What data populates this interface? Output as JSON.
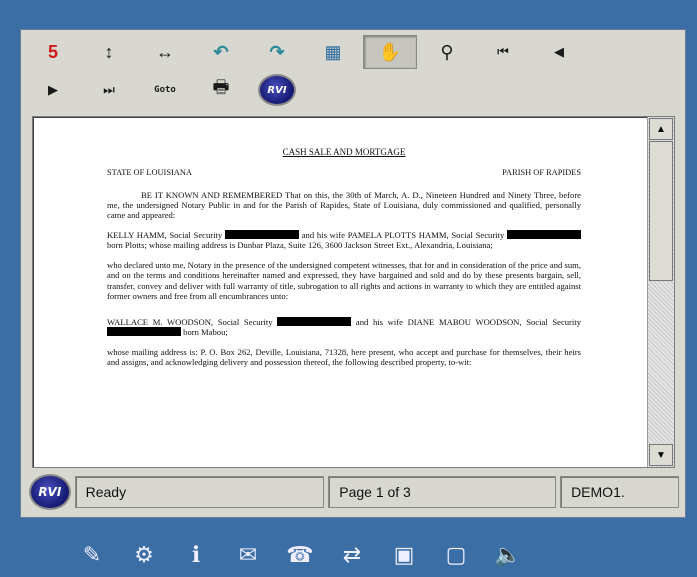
{
  "toolbar": {
    "row1": [
      {
        "name": "first-page-icon",
        "glyph": "5"
      },
      {
        "name": "fit-height-icon",
        "glyph": "↕"
      },
      {
        "name": "fit-width-icon",
        "glyph": "↔"
      },
      {
        "name": "rotate-left-icon",
        "glyph": "↶"
      },
      {
        "name": "rotate-right-icon",
        "glyph": "↷"
      },
      {
        "name": "thumbnails-icon",
        "glyph": "▦"
      },
      {
        "name": "pan-hand-icon",
        "glyph": "✋"
      },
      {
        "name": "zoom-icon",
        "glyph": "⚲"
      },
      {
        "name": "first-page-arrow-icon",
        "glyph": "⏮"
      },
      {
        "name": "previous-page-icon",
        "glyph": "◀"
      }
    ],
    "row2": [
      {
        "name": "next-page-icon",
        "glyph": "▶"
      },
      {
        "name": "last-page-icon",
        "glyph": "⏭"
      },
      {
        "name": "goto-icon",
        "glyph": "Goto"
      },
      {
        "name": "print-icon",
        "glyph": "🖶"
      },
      {
        "name": "rvi-logo-icon",
        "glyph": "RVI"
      }
    ]
  },
  "document": {
    "title": "CASH SALE AND MORTGAGE",
    "state": "STATE OF LOUISIANA",
    "parish": "PARISH OF RAPIDES",
    "p1": "BE IT KNOWN AND REMEMBERED That on this, the 30th of March, A. D., Nineteen Hundred and Ninety Three, before me, the undersigned Notary Public in and for the Parish of Rapides, State of Louisiana, duly commissioned and qualified, personally came and appeared:",
    "p2a": "KELLY HAMM, Social Security",
    "p2b": "and his wife PAMELA PLOTTS HAMM, Social Security",
    "p2c": "born Plotts; whose mailing address is Dunbar Plaza, Suite 126, 3600 Jackson Street Ext., Alexandria, Louisiana;",
    "p3": "who declared unto me, Notary in the presence of the undersigned competent witnesses, that for and in consideration of the price and sum, and on the terms and conditions hereinafter named and expressed, they have bargained and sold and do by these presents bargain, sell, transfer, convey and deliver with full warranty of title, subrogation to all rights and actions in warranty to which they are entitled against former owners and free from all encumbrances unto:",
    "p4a": "WALLACE M. WOODSON, Social Security",
    "p4b": "and his wife DIANE MABOU WOODSON, Social Security",
    "p4c": "born Mabou;",
    "p5": "whose mailing address is: P. O. Box 262, Deville, Louisiana, 71328, here present, who accept and purchase for themselves, their heirs and assigns, and acknowledging delivery and possession thereof, the following described property, to-wit:"
  },
  "scrollbar": {
    "up": "▲",
    "down": "▼"
  },
  "status": {
    "logo": "RVI",
    "state": "Ready",
    "page": "Page 1 of 3",
    "mode": "DEMO1."
  },
  "taskbar": [
    {
      "name": "edit-icon",
      "glyph": "✎"
    },
    {
      "name": "network-icon",
      "glyph": "⚙"
    },
    {
      "name": "info-icon",
      "glyph": "ℹ"
    },
    {
      "name": "mail-icon",
      "glyph": "✉"
    },
    {
      "name": "fax-icon",
      "glyph": "☎"
    },
    {
      "name": "transfer-icon",
      "glyph": "⇄"
    },
    {
      "name": "box-dark-icon",
      "glyph": "▣"
    },
    {
      "name": "box-light-icon",
      "glyph": "▢"
    },
    {
      "name": "speaker-icon",
      "glyph": "🔈"
    }
  ]
}
